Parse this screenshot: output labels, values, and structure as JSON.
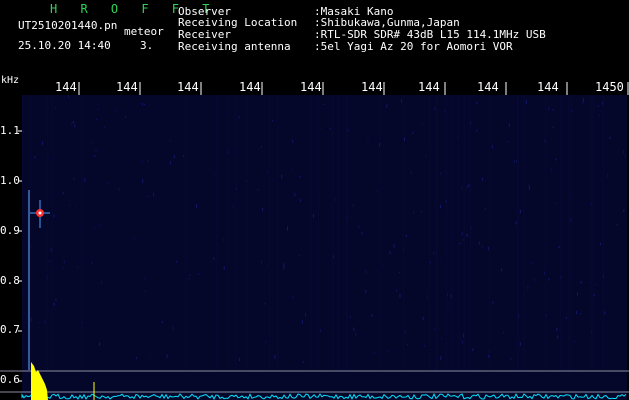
{
  "header": {
    "title": "H R O F F T",
    "file_name": "UT2510201440.pn",
    "meteor_label": "meteor",
    "date_time": "25.10.20 14:40",
    "count": "3."
  },
  "info": [
    {
      "label": "Observer",
      "value": ":Masaki Kano"
    },
    {
      "label": "Receiving Location",
      "value": ":Shibukawa,Gunma,Japan"
    },
    {
      "label": "Receiver",
      "value": ":RTL-SDR SDR# 43dB L15 114.1MHz USB"
    },
    {
      "label": "Receiving antenna",
      "value": ":5el Yagi Az 20 for Aomori VOR"
    }
  ],
  "axes": {
    "unit": "kHz",
    "x_ticks": [
      "144",
      "144",
      "144",
      "144",
      "144",
      "144",
      "144",
      "144",
      "144",
      "1450"
    ],
    "y_ticks": [
      "1.1",
      "1.0",
      "0.9",
      "0.8",
      "0.7",
      "0.6"
    ]
  },
  "colors": {
    "background": "#000000",
    "title": "#2fd35a",
    "plot_bg": "#04062a",
    "meteor_echo": "#ff3030",
    "spectrum": "#00e5ff",
    "peak": "#ffff00"
  }
}
